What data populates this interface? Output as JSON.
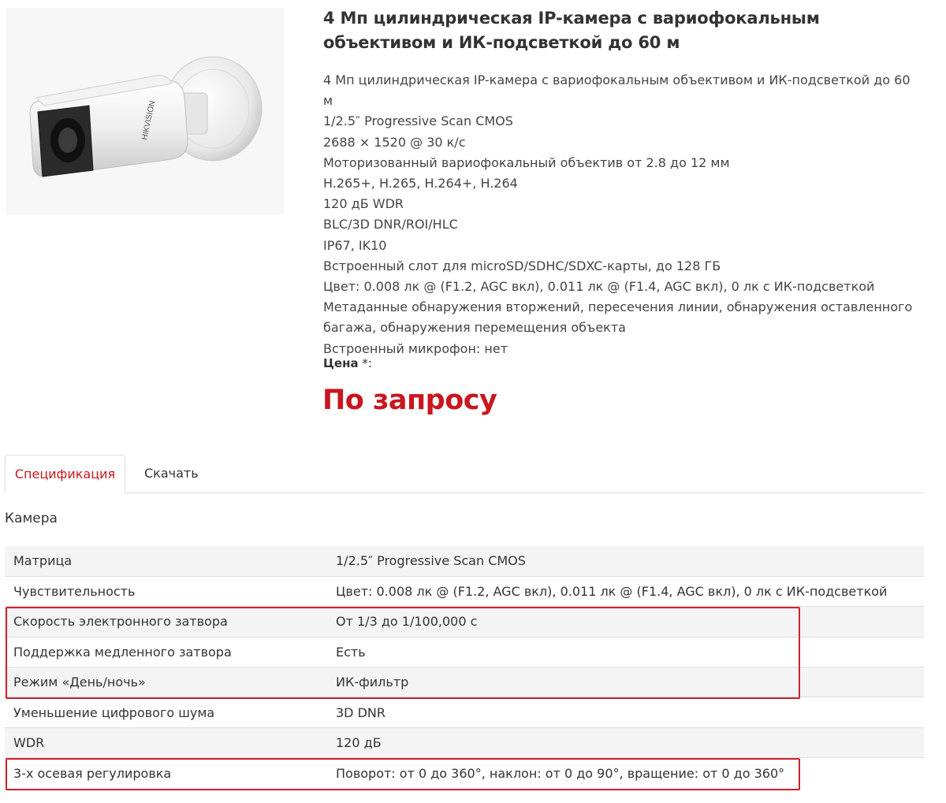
{
  "product": {
    "image_alt": "HIKVISION",
    "title": "4 Мп цилиндрическая IP-камера с вариофокальным объективом и ИК-подсветкой до 60 м",
    "features": [
      "4 Мп цилиндрическая IP-камера с вариофокальным объективом и ИК-подсветкой до 60 м",
      "1/2.5″ Progressive Scan CMOS",
      "2688 × 1520 @ 30 к/с",
      "Моторизованный вариофокальный объектив от 2.8 до 12 мм",
      "H.265+, H.265, H.264+, H.264",
      "120 дБ WDR",
      "BLC/3D DNR/ROI/HLC",
      "IP67, IK10",
      "Встроенный слот для microSD/SDHC/SDXC-карты, до 128 ГБ",
      "Цвет: 0.008 лк @ (F1.2, AGC вкл), 0.011 лк @ (F1.4, AGC вкл), 0 лк с ИК-подсветкой",
      "Метаданные обнаружения вторжений, пересечения линии, обнаружения оставленного багажа, обнаружения перемещения объекта",
      "Встроенный микрофон: нет"
    ],
    "price_label": "Цена",
    "price_asterisk": " *:",
    "price_value": "По запросу"
  },
  "tabs": {
    "specification": "Спецификация",
    "download": "Скачать"
  },
  "section_title": "Камера",
  "specs": [
    {
      "label": "Матрица",
      "value": "1/2.5″ Progressive Scan CMOS"
    },
    {
      "label": "Чувствительность",
      "value": "Цвет: 0.008 лк @ (F1.2, AGC вкл), 0.011 лк @ (F1.4, AGC вкл), 0 лк с ИК-подсветкой"
    },
    {
      "label": "Скорость электронного затвора",
      "value": "От 1/3 до 1/100,000 с"
    },
    {
      "label": "Поддержка медленного затвора",
      "value": "Есть"
    },
    {
      "label": "Режим «День/ночь»",
      "value": "ИК-фильтр"
    },
    {
      "label": "Уменьшение цифрового шума",
      "value": "3D DNR"
    },
    {
      "label": "WDR",
      "value": "120 дБ"
    },
    {
      "label": "3-х осевая регулировка",
      "value": "Поворот: от 0 до 360°, наклон: от 0 до 90°, вращение: от 0 до 360°"
    }
  ],
  "colors": {
    "accent": "#c8171f",
    "highlight": "#d0212a",
    "row_alt": "#f4f4f4",
    "border": "#dddddd"
  }
}
